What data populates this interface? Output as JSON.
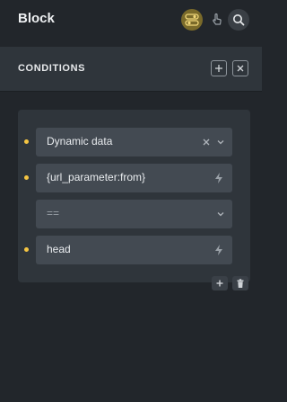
{
  "header": {
    "title": "Block",
    "icons": [
      "toggle-icon",
      "hand-pointer-icon",
      "search-icon"
    ],
    "accent": "#7a6a2a"
  },
  "conditions": {
    "title": "CONDITIONS",
    "icons": [
      "plus-icon",
      "close-icon"
    ]
  },
  "condition_rows": [
    {
      "value": "Dynamic data",
      "icons": [
        "clear-icon",
        "chevron-down-icon"
      ],
      "marked": true
    },
    {
      "value": "{url_parameter:from}",
      "icons": [
        "bolt-icon"
      ],
      "marked": true
    },
    {
      "value": "==",
      "icons": [
        "chevron-down-icon"
      ],
      "marked": false,
      "placeholder": true
    },
    {
      "value": "head",
      "icons": [
        "bolt-icon"
      ],
      "marked": true
    }
  ],
  "row_actions": [
    "plus-icon",
    "trash-icon"
  ],
  "colors": {
    "background": "#22262b",
    "panel": "#2f353b",
    "field": "#434a52",
    "dot": "#f5c542"
  }
}
